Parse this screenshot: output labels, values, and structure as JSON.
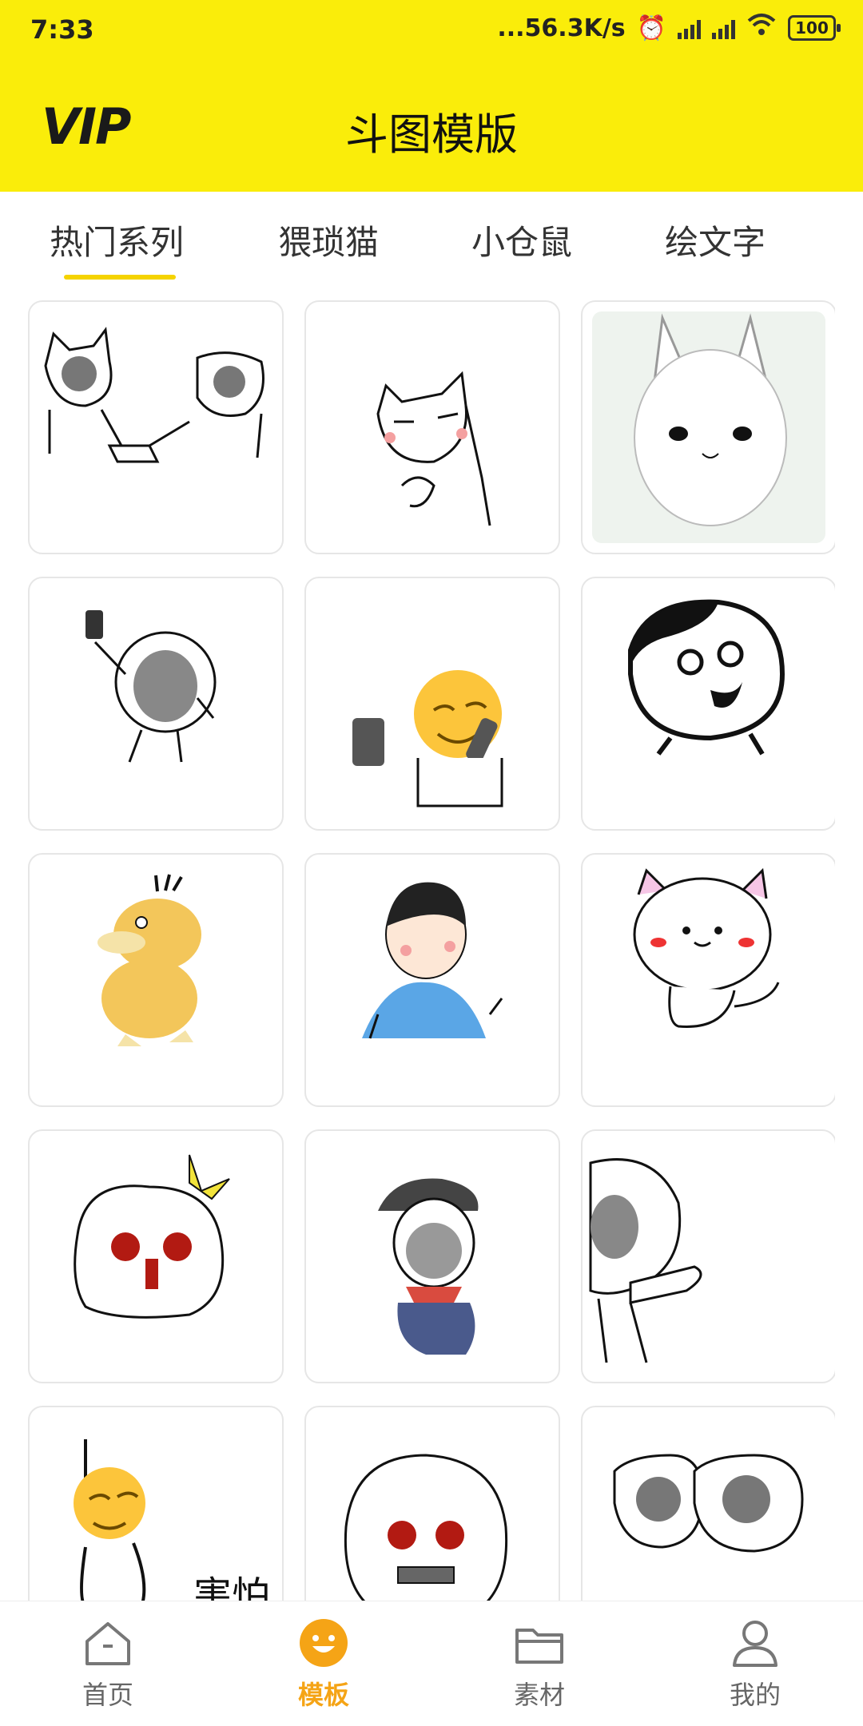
{
  "status_bar": {
    "time": "7:33",
    "network_speed": "...56.3K/s",
    "battery": "100"
  },
  "header": {
    "vip_label": "VIP",
    "title": "斗图模版"
  },
  "tabs": [
    {
      "label": "热门系列",
      "active": true
    },
    {
      "label": "猥琐猫",
      "active": false
    },
    {
      "label": "小仓鼠",
      "active": false
    },
    {
      "label": "绘文字",
      "active": false
    }
  ],
  "templates": [
    {
      "name": "cat-bear-handshake-meme"
    },
    {
      "name": "sly-cat-meme"
    },
    {
      "name": "shy-bunny-meme"
    },
    {
      "name": "selfie-face-meme"
    },
    {
      "name": "emoji-phone-call-meme"
    },
    {
      "name": "big-head-smile-meme"
    },
    {
      "name": "psyduck-meme"
    },
    {
      "name": "boy-pointing-meme"
    },
    {
      "name": "white-cat-blush-meme"
    },
    {
      "name": "crowned-girl-meme"
    },
    {
      "name": "crying-boy-meme"
    },
    {
      "name": "peeking-face-meme"
    },
    {
      "name": "scared-emoji-meme",
      "caption": "害怕"
    },
    {
      "name": "nervous-girl-meme"
    },
    {
      "name": "double-bear-meme"
    }
  ],
  "bottom_nav": [
    {
      "label": "首页",
      "icon": "home-icon",
      "active": false
    },
    {
      "label": "模板",
      "icon": "smile-face-icon",
      "active": true
    },
    {
      "label": "素材",
      "icon": "folder-icon",
      "active": false
    },
    {
      "label": "我的",
      "icon": "user-icon",
      "active": false
    }
  ],
  "colors": {
    "header_yellow": "#FAED0A",
    "accent": "#F5A416",
    "indicator": "#F5D300"
  }
}
